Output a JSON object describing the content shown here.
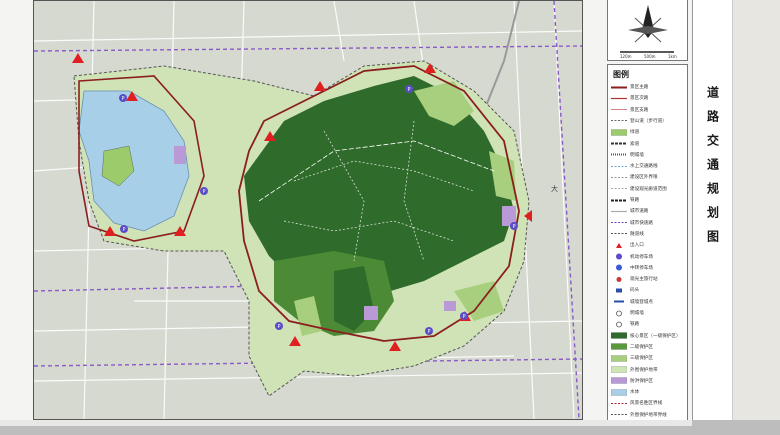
{
  "title": "道路交通规划图",
  "legend_title": "图例",
  "scale": {
    "labels": [
      "120m",
      "500m",
      "1km"
    ]
  },
  "legend_items": [
    {
      "label": "景区主路",
      "color": "#8b1e1e",
      "kind": "line-thick"
    },
    {
      "label": "景区次路",
      "color": "#b03333",
      "kind": "line"
    },
    {
      "label": "景区支路",
      "color": "#c86464",
      "kind": "line-thin"
    },
    {
      "label": "登山道（步行道）",
      "color": "#666666",
      "kind": "line-dash"
    },
    {
      "label": "绿道",
      "color": "#9ccb6c",
      "kind": "fill"
    },
    {
      "label": "索道",
      "color": "#333333",
      "kind": "line-rail"
    },
    {
      "label": "明城墙",
      "color": "#555555",
      "kind": "line-dots"
    },
    {
      "label": "水上交通路线",
      "color": "#6aa9d8",
      "kind": "line-dash"
    },
    {
      "label": "建设区外界限",
      "color": "#999999",
      "kind": "line-dash"
    },
    {
      "label": "建设观光廊道范围",
      "color": "#aaaaaa",
      "kind": "line-dash"
    },
    {
      "label": "铁路",
      "color": "#222222",
      "kind": "line-rail"
    },
    {
      "label": "城市道路",
      "color": "#aaaaaa",
      "kind": "line"
    },
    {
      "label": "城市快速路",
      "color": "#7f3fbf",
      "kind": "line-dash"
    },
    {
      "label": "隧道线",
      "color": "#555555",
      "kind": "line-dash"
    },
    {
      "label": "出入口",
      "color": "#e02020",
      "kind": "triangle"
    },
    {
      "label": "机动停车场",
      "color": "#5a4cc8",
      "kind": "circle-p"
    },
    {
      "label": "中转停车场",
      "color": "#3a5bd8",
      "kind": "circle-p"
    },
    {
      "label": "观光主旅行站",
      "color": "#c83a3a",
      "kind": "circle"
    },
    {
      "label": "码头",
      "color": "#2a4fa8",
      "kind": "rect"
    },
    {
      "label": "城墙登城点",
      "color": "#2a4fa8",
      "kind": "bar"
    },
    {
      "label": "明城墙",
      "color": "#555555",
      "kind": "circle-o"
    },
    {
      "label": "铁路",
      "color": "#555555",
      "kind": "circle-o"
    },
    {
      "label": "核心景区（一级保护区）",
      "color": "#2f6b2a",
      "kind": "fill"
    },
    {
      "label": "二级保护区",
      "color": "#5b9a3c",
      "kind": "fill"
    },
    {
      "label": "三级保护区",
      "color": "#a7cf7d",
      "kind": "fill"
    },
    {
      "label": "外围保护地带",
      "color": "#cfe6b3",
      "kind": "fill"
    },
    {
      "label": "防洪保护区",
      "color": "#b99ad6",
      "kind": "fill"
    },
    {
      "label": "水体",
      "color": "#a7cfe8",
      "kind": "fill"
    },
    {
      "label": "风景名胜区界线",
      "color": "#b02a2a",
      "kind": "line-dash"
    },
    {
      "label": "外围保护地带界线",
      "color": "#555555",
      "kind": "line-dash"
    }
  ],
  "map_labels": {
    "da": "大"
  },
  "colors": {
    "forest": "#2f6b2a",
    "forest_mid": "#4c8a36",
    "light_green": "#a7cf7d",
    "water": "#a7cfe8",
    "purple": "#8a5bc8",
    "road_red": "#b02a2a",
    "entrance": "#e02020"
  }
}
